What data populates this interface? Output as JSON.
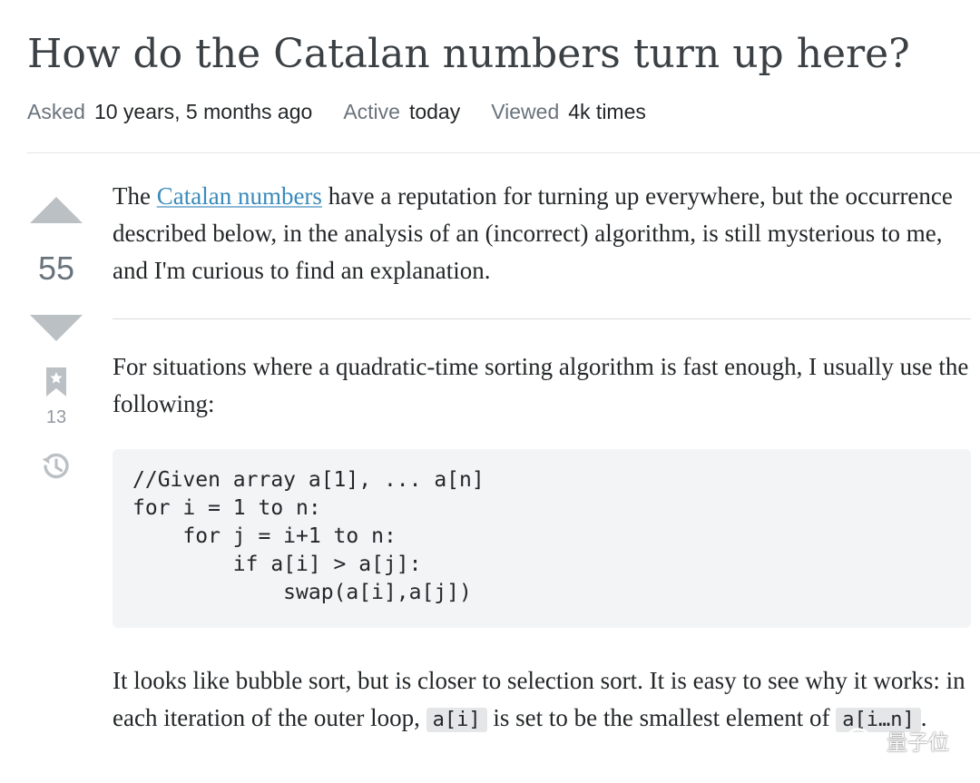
{
  "question": {
    "title": "How do the Catalan numbers turn up here?"
  },
  "meta": {
    "asked_label": "Asked",
    "asked_value": "10 years, 5 months ago",
    "active_label": "Active",
    "active_value": "today",
    "viewed_label": "Viewed",
    "viewed_value": "4k times"
  },
  "votes": {
    "score": "55",
    "bookmark_count": "13",
    "icons": {
      "upvote": "caret-up-icon",
      "downvote": "caret-down-icon",
      "bookmark": "bookmark-star-icon",
      "history": "history-clock-icon"
    }
  },
  "post": {
    "p1_before": "The ",
    "p1_link": "Catalan numbers",
    "p1_after": " have a reputation for turning up everywhere, but the occurrence described below, in the analysis of an (incorrect) algorithm, is still mysterious to me, and I'm curious to find an explanation.",
    "p2": "For situations where a quadratic-time sorting algorithm is fast enough, I usually use the following:",
    "code": "//Given array a[1], ... a[n]\nfor i = 1 to n:\n    for j = i+1 to n:\n        if a[i] > a[j]:\n            swap(a[i],a[j])",
    "p3_part1": "It looks like bubble sort, but is closer to selection sort. It is easy to see why it works: in each iteration of the outer loop, ",
    "p3_code1": "a[i]",
    "p3_part2": " is set to be the smallest element of ",
    "p3_code2": "a[i…n]",
    "p3_part3": "."
  },
  "watermark": {
    "text": "量子位",
    "icon": "wechat-icon"
  },
  "colors": {
    "link": "#3a8bbb",
    "vote_arrow": "#bbc0c4",
    "muted_text": "#6a737c",
    "code_bg": "#f3f4f5",
    "divider": "#d6d9dc"
  }
}
